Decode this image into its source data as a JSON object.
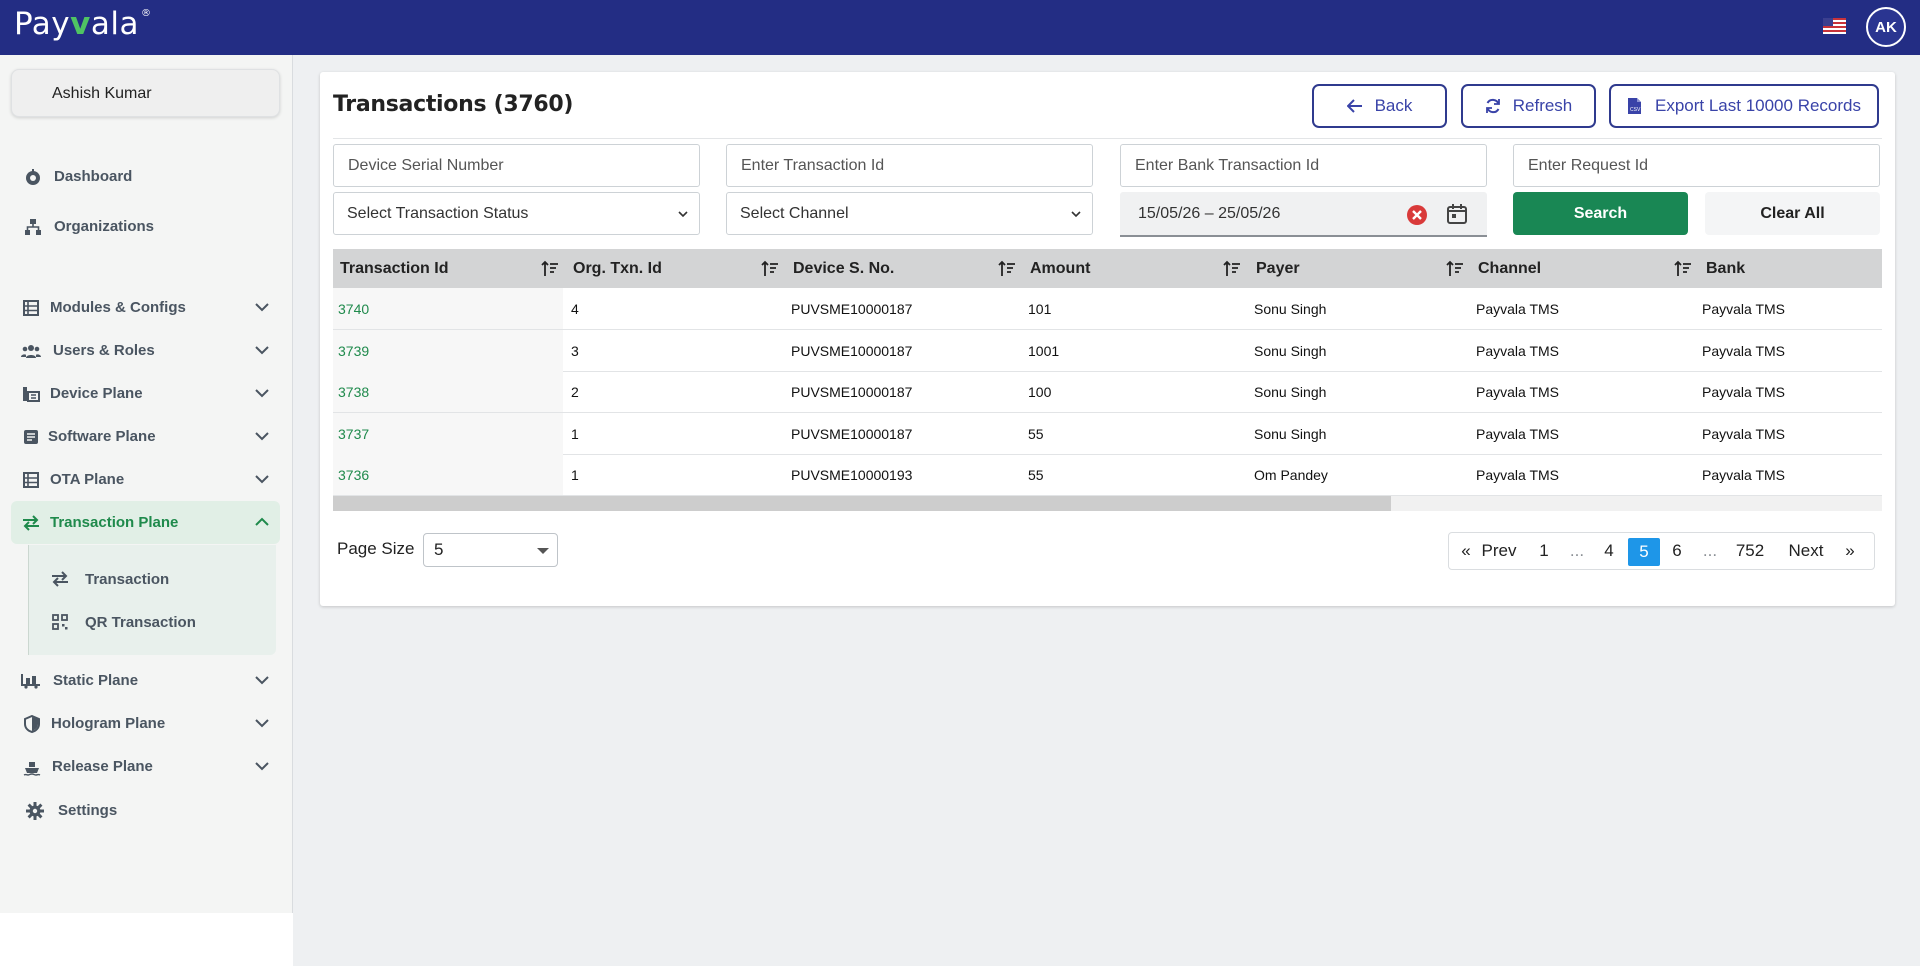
{
  "app": {
    "brand_left": "Pay",
    "brand_mark": "v",
    "brand_right": "ala",
    "brand_reg": "®",
    "avatar_initials": "AK",
    "flag_icon": "us-flag-icon"
  },
  "colors": {
    "header": "#232d84",
    "accent_green": "#198754",
    "active_page": "#1e96e8"
  },
  "sidebar": {
    "user_name": "Ashish Kumar",
    "items": [
      {
        "label": "Dashboard",
        "icon": "dashboard-icon"
      },
      {
        "label": "Organizations",
        "icon": "organizations-icon"
      },
      {
        "label": "Modules & Configs",
        "icon": "modules-icon"
      },
      {
        "label": "Users & Roles",
        "icon": "users-icon"
      },
      {
        "label": "Device Plane",
        "icon": "device-icon"
      },
      {
        "label": "Software Plane",
        "icon": "software-icon"
      },
      {
        "label": "OTA Plane",
        "icon": "ota-icon"
      },
      {
        "label": "Transaction Plane",
        "icon": "transaction-icon"
      },
      {
        "label": "Static Plane",
        "icon": "static-icon"
      },
      {
        "label": "Hologram Plane",
        "icon": "hologram-icon"
      },
      {
        "label": "Release Plane",
        "icon": "release-icon"
      },
      {
        "label": "Settings",
        "icon": "gear-icon"
      }
    ],
    "sub_items": [
      {
        "label": "Transaction",
        "icon": "swap-icon"
      },
      {
        "label": "QR Transaction",
        "icon": "qr-icon"
      }
    ]
  },
  "main": {
    "title": "Transactions (3760)",
    "buttons": {
      "back": "Back",
      "refresh": "Refresh",
      "export": "Export Last 10000 Records"
    },
    "filters": {
      "device_serial_placeholder": "Device Serial Number",
      "transaction_id_placeholder": "Enter Transaction Id",
      "bank_txn_placeholder": "Enter Bank Transaction Id",
      "request_id_placeholder": "Enter Request Id",
      "status_select": "Select Transaction Status",
      "channel_select": "Select Channel",
      "date_range": "15/05/26 – 25/05/26",
      "search": "Search",
      "clear_all": "Clear All"
    },
    "table": {
      "columns": [
        "Transaction Id",
        "Org. Txn. Id",
        "Device S. No.",
        "Amount",
        "Payer",
        "Channel",
        "Bank"
      ],
      "rows": [
        [
          "3740",
          "4",
          "PUVSME10000187",
          "101",
          "Sonu Singh",
          "Payvala TMS",
          "Payvala TMS"
        ],
        [
          "3739",
          "3",
          "PUVSME10000187",
          "1001",
          "Sonu Singh",
          "Payvala TMS",
          "Payvala TMS"
        ],
        [
          "3738",
          "2",
          "PUVSME10000187",
          "100",
          "Sonu Singh",
          "Payvala TMS",
          "Payvala TMS"
        ],
        [
          "3737",
          "1",
          "PUVSME10000187",
          "55",
          "Sonu Singh",
          "Payvala TMS",
          "Payvala TMS"
        ],
        [
          "3736",
          "1",
          "PUVSME10000193",
          "55",
          "Om Pandey",
          "Payvala TMS",
          "Payvala TMS"
        ]
      ]
    },
    "pagination": {
      "page_size_label": "Page Size",
      "page_size": "5",
      "first_arrow": "«",
      "prev": "Prev",
      "pages": [
        "1",
        "...",
        "4",
        "5",
        "6",
        "...",
        "752"
      ],
      "active_page": "5",
      "next": "Next",
      "last_arrow": "»"
    }
  }
}
